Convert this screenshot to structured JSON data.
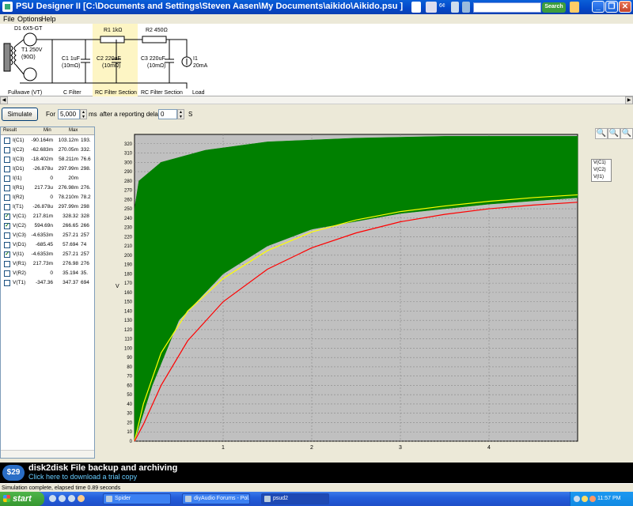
{
  "window": {
    "app_name": "PSU Designer II",
    "title": "PSU Designer II  [C:\\Documents and Settings\\Steven Aasen\\My Documents\\aikido\\Aikido.psu ]",
    "search_button": "Search",
    "minimize": "_",
    "restore": "❐",
    "close": "✕"
  },
  "toolbar_icons": {
    "weather_text": "6¢"
  },
  "menu": [
    "File",
    "Options",
    "Help"
  ],
  "schematic": {
    "d1_label": "D1 6X5-GT",
    "t1_label": "T1 250V",
    "t1_sub": "(90Ω)",
    "r1_label": "R1 1kΩ",
    "r2_label": "R2 450Ω",
    "c1_label": "C1 1uF",
    "c1_sub": "(10mΩ)",
    "c2_label": "C2 220uF",
    "c2_sub": "(10mΩ)",
    "c3_label": "C3 220uF",
    "c3_sub": "(10mΩ)",
    "i1_label": "I1",
    "i1_sub": "20mA",
    "sections": [
      "Fullwave (VT)",
      "C Filter",
      "RC Filter Section",
      "RC Filter Section",
      "Load"
    ]
  },
  "sim": {
    "button": "Simulate",
    "for_label": "For",
    "duration": "5,000",
    "ms_label": "ms",
    "delay_label": "after a reporting delay of",
    "delay": "0",
    "s_label": "S"
  },
  "results": {
    "headers": [
      "Result",
      "Min",
      "Max"
    ],
    "rows": [
      {
        "name": "I(C1)",
        "min": "-90.164m",
        "max": "103.12m",
        "extra": "193.",
        "checked": false
      },
      {
        "name": "I(C2)",
        "min": "-62.683m",
        "max": "270.05m",
        "extra": "332.",
        "checked": false
      },
      {
        "name": "I(C3)",
        "min": "-18.402m",
        "max": "58.211m",
        "extra": "76.6",
        "checked": false
      },
      {
        "name": "I(D1)",
        "min": "-26.878u",
        "max": "297.99m",
        "extra": "298.",
        "checked": false
      },
      {
        "name": "I(I1)",
        "min": "0",
        "max": "20m",
        "extra": "",
        "checked": false
      },
      {
        "name": "I(R1)",
        "min": "217.73u",
        "max": "276.98m",
        "extra": "276.",
        "checked": false
      },
      {
        "name": "I(R2)",
        "min": "0",
        "max": "78.210m",
        "extra": "78.2",
        "checked": false
      },
      {
        "name": "I(T1)",
        "min": "-26.878u",
        "max": "297.99m",
        "extra": "298",
        "checked": false
      },
      {
        "name": "V(C1)",
        "min": "217.81m",
        "max": "328.32",
        "extra": "328",
        "checked": true
      },
      {
        "name": "V(C2)",
        "min": "594.69n",
        "max": "266.65",
        "extra": "266",
        "checked": true
      },
      {
        "name": "V(C3)",
        "min": "-4.6353m",
        "max": "257.21",
        "extra": "257",
        "checked": false
      },
      {
        "name": "V(D1)",
        "min": "-685.45",
        "max": "57.694",
        "extra": "74",
        "checked": false
      },
      {
        "name": "V(I1)",
        "min": "-4.6353m",
        "max": "257.21",
        "extra": "257",
        "checked": true
      },
      {
        "name": "V(R1)",
        "min": "217.73m",
        "max": "276.98",
        "extra": "276",
        "checked": false
      },
      {
        "name": "V(R2)",
        "min": "0",
        "max": "35.194",
        "extra": "35.",
        "checked": false
      },
      {
        "name": "V(T1)",
        "min": "-347.36",
        "max": "347.37",
        "extra": "694",
        "checked": false
      }
    ]
  },
  "chart_data": {
    "type": "line",
    "ylabel": "V",
    "xlabel": "",
    "xlim": [
      0,
      5
    ],
    "ylim": [
      0,
      330
    ],
    "x_ticks": [
      1,
      2,
      3,
      4
    ],
    "y_ticks": [
      0,
      10,
      20,
      30,
      40,
      50,
      60,
      70,
      80,
      90,
      100,
      110,
      120,
      130,
      140,
      150,
      160,
      170,
      180,
      190,
      200,
      210,
      220,
      230,
      240,
      250,
      260,
      270,
      280,
      290,
      300,
      310,
      320
    ],
    "grid": true,
    "legend_position": "right",
    "series": [
      {
        "name": "V(C1)",
        "color": "#008000",
        "envelope_upper": [
          [
            0,
            250
          ],
          [
            0.05,
            280
          ],
          [
            0.3,
            300
          ],
          [
            0.8,
            313
          ],
          [
            1.5,
            322
          ],
          [
            2.5,
            326
          ],
          [
            3.5,
            328
          ],
          [
            5,
            328
          ]
        ],
        "envelope_lower": [
          [
            0,
            0
          ],
          [
            0.2,
            60
          ],
          [
            0.5,
            130
          ],
          [
            1,
            180
          ],
          [
            1.5,
            210
          ],
          [
            2,
            228
          ],
          [
            3,
            245
          ],
          [
            4,
            255
          ],
          [
            5,
            262
          ]
        ]
      },
      {
        "name": "V(C2)",
        "color": "#ffff00",
        "values": [
          [
            0,
            0
          ],
          [
            0.1,
            40
          ],
          [
            0.3,
            95
          ],
          [
            0.6,
            140
          ],
          [
            1,
            175
          ],
          [
            1.5,
            205
          ],
          [
            2,
            225
          ],
          [
            2.5,
            238
          ],
          [
            3,
            247
          ],
          [
            3.5,
            253
          ],
          [
            4,
            258
          ],
          [
            4.5,
            262
          ],
          [
            5,
            265
          ]
        ]
      },
      {
        "name": "V(I1)",
        "color": "#ff0000",
        "values": [
          [
            0,
            0
          ],
          [
            0.1,
            18
          ],
          [
            0.3,
            60
          ],
          [
            0.6,
            108
          ],
          [
            1,
            150
          ],
          [
            1.5,
            185
          ],
          [
            2,
            208
          ],
          [
            2.5,
            224
          ],
          [
            3,
            236
          ],
          [
            3.5,
            244
          ],
          [
            4,
            250
          ],
          [
            4.5,
            254
          ],
          [
            5,
            257
          ]
        ]
      }
    ]
  },
  "ad": {
    "price": "$29",
    "title": "disk2disk File backup and archiving",
    "subtitle": "Click here to download a trial copy"
  },
  "status": "Simulation complete, elapsed time 0.89 seconds",
  "taskbar": {
    "start": "start",
    "tasks": [
      "Spider",
      "diyAudio Forums - Pol...",
      "psud2"
    ],
    "clock": "11:57 PM"
  }
}
